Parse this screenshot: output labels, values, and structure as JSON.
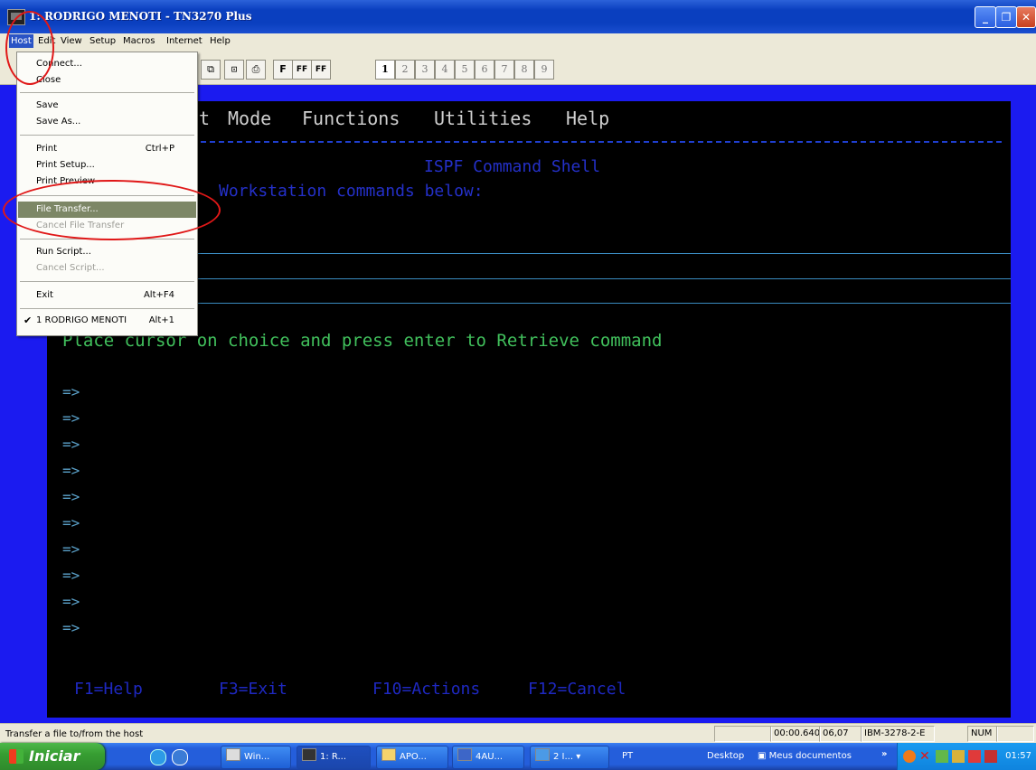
{
  "window": {
    "title": "1: RODRIGO MENOTI - TN3270 Plus"
  },
  "menubar": [
    "Host",
    "Edit",
    "View",
    "Setup",
    "Macros",
    "Internet",
    "Help"
  ],
  "toolbar": {
    "font_buttons": [
      "F",
      "FF",
      "FF"
    ],
    "sessions": [
      "1",
      "2",
      "3",
      "4",
      "5",
      "6",
      "7",
      "8",
      "9"
    ]
  },
  "host_menu": {
    "items": [
      {
        "label": "Connect...",
        "shortcut": "",
        "state": "normal"
      },
      {
        "label": "Close",
        "shortcut": "",
        "state": "normal"
      },
      {
        "label": "Save",
        "shortcut": "",
        "state": "normal"
      },
      {
        "label": "Save As...",
        "shortcut": "",
        "state": "normal"
      },
      {
        "label": "Print",
        "shortcut": "Ctrl+P",
        "state": "normal"
      },
      {
        "label": "Print Setup...",
        "shortcut": "",
        "state": "normal"
      },
      {
        "label": "Print Preview",
        "shortcut": "",
        "state": "normal"
      },
      {
        "label": "File Transfer...",
        "shortcut": "",
        "state": "selected"
      },
      {
        "label": "Cancel File Transfer",
        "shortcut": "",
        "state": "disabled"
      },
      {
        "label": "Run Script...",
        "shortcut": "",
        "state": "normal"
      },
      {
        "label": "Cancel Script...",
        "shortcut": "",
        "state": "disabled"
      },
      {
        "label": "Exit",
        "shortcut": "Alt+F4",
        "state": "normal"
      },
      {
        "label": "1 RODRIGO MENOTI",
        "shortcut": "Alt+1",
        "state": "checked"
      }
    ]
  },
  "terminal": {
    "menu_partial": "t",
    "menu": [
      "Mode",
      "Functions",
      "Utilities",
      "Help"
    ],
    "title": "ISPF Command Shell",
    "enter_label": "Workstation commands below:",
    "instruction": "Place cursor on choice and press enter to Retrieve command",
    "prompt": "=>",
    "prompt_count": 10,
    "fkeys": [
      "F1=Help",
      "F3=Exit",
      "F10=Actions",
      "F12=Cancel"
    ]
  },
  "status": {
    "message": "Transfer a file to/from the host",
    "timer": "00:00.640",
    "cursor": "06,07",
    "model": "IBM-3278-2-E",
    "num": "NUM"
  },
  "taskbar": {
    "start": "Iniciar",
    "tasks": [
      "Win...",
      "1: R...",
      "APO...",
      "4AU...",
      "2 I..."
    ],
    "language": "PT",
    "desktop_label": "Desktop",
    "docs_label": "Meus documentos",
    "clock": "01:57"
  },
  "colors": {
    "terminal_bg": "#000000",
    "frame_blue": "#1b1bf0",
    "green_text": "#41c05c",
    "highlight_circle": "#e01818"
  }
}
